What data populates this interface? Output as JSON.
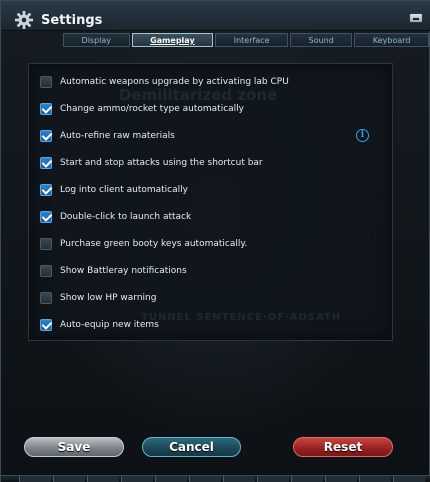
{
  "window": {
    "title": "Settings"
  },
  "tabs": [
    {
      "label": "Display",
      "active": false
    },
    {
      "label": "Gameplay",
      "active": true
    },
    {
      "label": "Interface",
      "active": false
    },
    {
      "label": "Sound",
      "active": false
    },
    {
      "label": "Keyboard",
      "active": false
    }
  ],
  "options": [
    {
      "label": "Automatic weapons upgrade by activating lab CPU",
      "checked": false
    },
    {
      "label": "Change ammo/rocket type automatically",
      "checked": true
    },
    {
      "label": "Auto-refine raw materials",
      "checked": true
    },
    {
      "label": "Start and stop attacks using the shortcut bar",
      "checked": true
    },
    {
      "label": "Log into client automatically",
      "checked": true
    },
    {
      "label": "Double-click to launch attack",
      "checked": true
    },
    {
      "label": "Purchase green booty keys automatically.",
      "checked": false
    },
    {
      "label": "Show Battleray notifications",
      "checked": false
    },
    {
      "label": "Show low HP warning",
      "checked": false
    },
    {
      "label": "Auto-equip new items",
      "checked": true
    }
  ],
  "info_icon": {
    "glyph": "i",
    "icon": "info-icon",
    "color": "#2ba4e6"
  },
  "background_text": {
    "zone": "Demilitarized zone",
    "signature": "TUNNEL SENTENCE·OF·ADSATH"
  },
  "buttons": {
    "save": "Save",
    "cancel": "Cancel",
    "reset": "Reset"
  },
  "colors": {
    "checkbox_on": "#2d82c9",
    "save": "#8a9299",
    "cancel": "#1e4858",
    "reset": "#9a2220"
  }
}
